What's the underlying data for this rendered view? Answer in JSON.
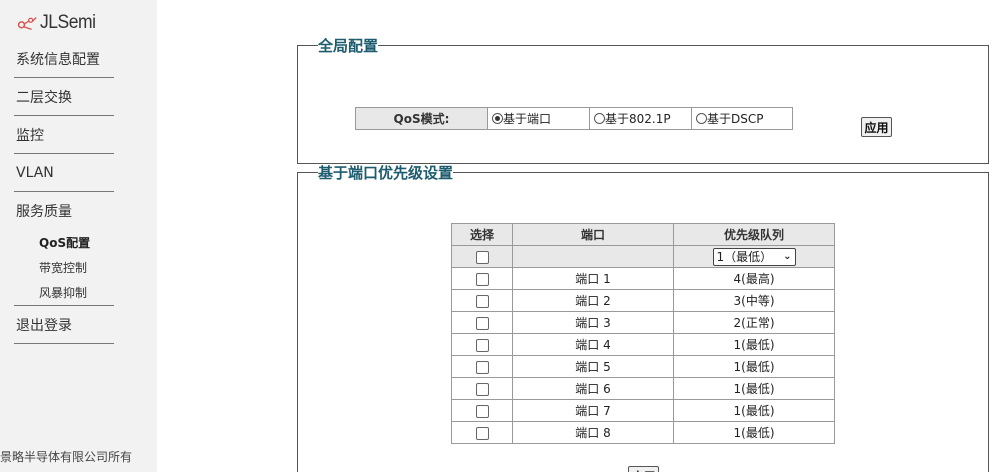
{
  "brand": {
    "logo_text": "JLSemi"
  },
  "sidebar": {
    "items": [
      {
        "label": "系统信息配置"
      },
      {
        "label": "二层交换"
      },
      {
        "label": "监控"
      },
      {
        "label": "VLAN"
      }
    ],
    "qos_group": {
      "label": "服务质量",
      "sub_items": [
        {
          "label": "QoS配置",
          "active": true
        },
        {
          "label": "带宽控制",
          "active": false
        },
        {
          "label": "风暴抑制",
          "active": false
        }
      ]
    },
    "logout": "退出登录",
    "footer": "景略半导体有限公司所有"
  },
  "global_config": {
    "legend": "全局配置",
    "mode_label": "QoS模式:",
    "options": [
      {
        "label": "基于端口",
        "checked": true
      },
      {
        "label": "基于802.1P",
        "checked": false
      },
      {
        "label": "基于DSCP",
        "checked": false
      }
    ],
    "apply_label": "应用"
  },
  "port_priority": {
    "legend": "基于端口优先级设置",
    "headers": {
      "select": "选择",
      "port": "端口",
      "queue": "优先级队列"
    },
    "bulk_select_value": "1（最低）",
    "rows": [
      {
        "port": "端口 1",
        "queue": "4(最高)"
      },
      {
        "port": "端口 2",
        "queue": "3(中等)"
      },
      {
        "port": "端口 3",
        "queue": "2(正常)"
      },
      {
        "port": "端口 4",
        "queue": "1(最低)"
      },
      {
        "port": "端口 5",
        "queue": "1(最低)"
      },
      {
        "port": "端口 6",
        "queue": "1(最低)"
      },
      {
        "port": "端口 7",
        "queue": "1(最低)"
      },
      {
        "port": "端口 8",
        "queue": "1(最低)"
      }
    ],
    "apply_label": "应用"
  },
  "colors": {
    "legend": "#1d5c6e",
    "sidebar_bg": "#f2f2f2",
    "logo_accent": "#d9534f"
  }
}
